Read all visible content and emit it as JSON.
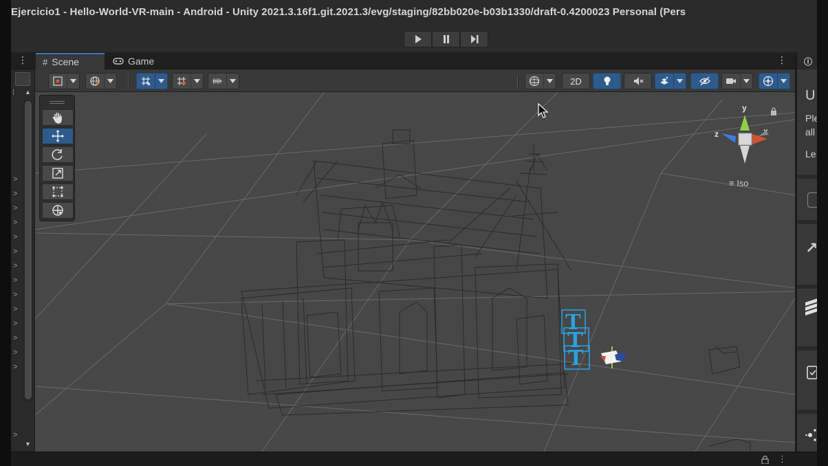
{
  "window": {
    "title": "Ejercicio1 - Hello-World-VR-main - Android - Unity 2021.3.16f1.git.2021.3/evg/staging/82bb020e-b03b1330/draft-0.4200023 Personal (Pers"
  },
  "tabs": [
    {
      "label": "Scene",
      "icon": "grid-hash-icon",
      "active": true
    },
    {
      "label": "Game",
      "icon": "gamepad-icon",
      "active": false
    }
  ],
  "scene_toolbar": {
    "mode_2d_label": "2D"
  },
  "gizmo": {
    "axis_x": "x",
    "axis_y": "y",
    "axis_z": "z",
    "projection_label": "Iso"
  },
  "inspector_partial": {
    "title_fragment": "U",
    "line1": "Ple",
    "line2": "all",
    "line3": "Le"
  },
  "colors": {
    "accent_blue": "#2d5b8c",
    "tab_highlight": "#3a79bb",
    "axis_x": "#d0532c",
    "axis_y": "#8fd145",
    "axis_z": "#3d7be0",
    "text_selection": "#29a3e6"
  }
}
